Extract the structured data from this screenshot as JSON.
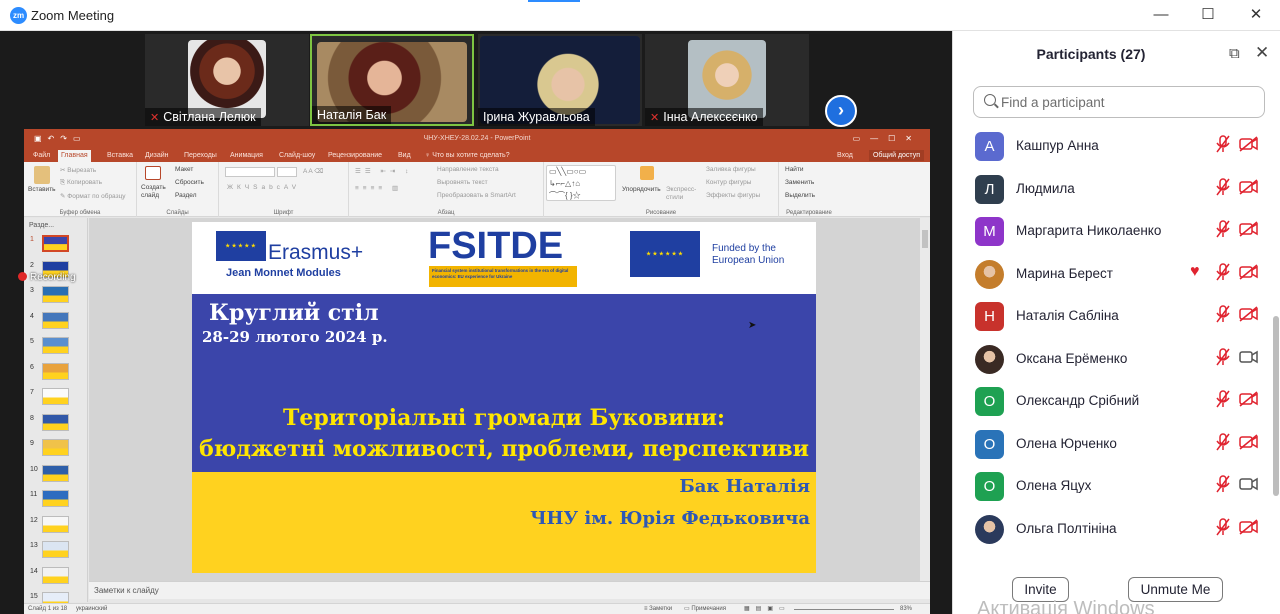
{
  "window": {
    "title": "Zoom Meeting",
    "logo_text": "zm",
    "minimize": "—",
    "maximize": "☐",
    "close": "✕"
  },
  "video_strip": {
    "participants": [
      {
        "name": "Світлана Лелюк",
        "muted": true,
        "active": false
      },
      {
        "name": "Наталія Бак",
        "muted": false,
        "active": true
      },
      {
        "name": "Ірина Журавльова",
        "muted": false,
        "active": false
      },
      {
        "name": "Інна Алексєєнко",
        "muted": true,
        "active": false
      }
    ],
    "next_icon": "chevron-right"
  },
  "recording_label": "Recording",
  "powerpoint": {
    "doc_title": "ЧНУ-ХНЕУ-28.02.24 - PowerPoint",
    "tabs": [
      "Файл",
      "Главная",
      "Вставка",
      "Дизайн",
      "Переходы",
      "Анимация",
      "Слайд-шоу",
      "Рецензирование",
      "Вид"
    ],
    "active_tab": "Главная",
    "tell_me": "Что вы хотите сделать?",
    "signin": "Вход",
    "share": "Общий доступ",
    "ribbon": {
      "paste": "Вставить",
      "cut": "Вырезать",
      "copy": "Копировать",
      "format_painter": "Формат по образцу",
      "clipboard": "Буфер обмена",
      "new_slide": "Создать слайд",
      "layout": "Макет",
      "reset": "Сбросить",
      "section": "Раздел",
      "slides": "Слайды",
      "font": "Шрифт",
      "paragraph": "Абзац",
      "text_direction": "Направление текста",
      "align_text": "Выровнять текст",
      "smartart": "Преобразовать в SmartArt",
      "arrange": "Упорядочить",
      "quick_styles": "Экспресс-стили",
      "shape_fill": "Заливка фигуры",
      "shape_outline": "Контур фигуры",
      "shape_effects": "Эффекты фигуры",
      "drawing": "Рисование",
      "find": "Найти",
      "replace": "Заменить",
      "select": "Выделить",
      "editing": "Редактирование"
    },
    "thumbs_header": "Разде...",
    "thumbnails": [
      "1",
      "2",
      "3",
      "4",
      "5",
      "6",
      "7",
      "8",
      "9",
      "10",
      "11",
      "12",
      "13",
      "14",
      "15"
    ],
    "notes_placeholder": "Заметки к слайду",
    "status": {
      "slide_of": "Слайд 1 из 18",
      "language": "украинский",
      "notes": "Заметки",
      "comments": "Примечания",
      "zoom": "83%"
    }
  },
  "slide": {
    "erasmus": "Erasmus+",
    "jean_monnet": "Jean Monnet Modules",
    "fsitde": "FSITDE",
    "fsitde_sub": "Financial system institutional transformations in the era of digital economics: EU experience for Ukraine",
    "funded": "Funded by the European Union",
    "event": "Круглий стіл",
    "date": "28-29 лютого 2024 р.",
    "topic_line1": "Територіальні громади Буковини:",
    "topic_line2": "бюджетні можливості, проблеми, перспективи",
    "author": "Бак Наталія",
    "affiliation": "ЧНУ ім. Юрія Федьковича",
    "colors": {
      "blue": "#3b45aa",
      "yellow": "#ffd21f",
      "title_yellow": "#ffe600",
      "author_blue": "#2e58b5"
    }
  },
  "panel": {
    "title": "Participants (27)",
    "search_placeholder": "Find a participant",
    "participants": [
      {
        "initial": "А",
        "name": "Кашпур Анна",
        "color": "#5b6acf",
        "photo": false,
        "heart": false,
        "mic_muted": true,
        "video_off": true
      },
      {
        "initial": "Л",
        "name": "Людмила",
        "color": "#2f3e4e",
        "photo": false,
        "heart": false,
        "mic_muted": true,
        "video_off": true
      },
      {
        "initial": "М",
        "name": "Маргарита Николаенко",
        "color": "#8e35c9",
        "photo": false,
        "heart": false,
        "mic_muted": true,
        "video_off": true
      },
      {
        "initial": "",
        "name": "Марина Берест",
        "color": "#c47d2c",
        "photo": true,
        "heart": true,
        "mic_muted": true,
        "video_off": true
      },
      {
        "initial": "Н",
        "name": "Наталія Сабліна",
        "color": "#c8322c",
        "photo": false,
        "heart": false,
        "mic_muted": true,
        "video_off": true
      },
      {
        "initial": "",
        "name": "Оксана Ерёменко",
        "color": "#3a2a24",
        "photo": true,
        "heart": false,
        "mic_muted": true,
        "video_off": false
      },
      {
        "initial": "О",
        "name": "Олександр Срібний",
        "color": "#1ea152",
        "photo": false,
        "heart": false,
        "mic_muted": true,
        "video_off": true
      },
      {
        "initial": "О",
        "name": "Олена Юрченко",
        "color": "#2a73b8",
        "photo": false,
        "heart": false,
        "mic_muted": true,
        "video_off": true
      },
      {
        "initial": "О",
        "name": "Олена Яцух",
        "color": "#1ea152",
        "photo": false,
        "heart": false,
        "mic_muted": true,
        "video_off": false
      },
      {
        "initial": "",
        "name": "Ольга Полтініна",
        "color": "#2b3a5c",
        "photo": true,
        "heart": false,
        "mic_muted": true,
        "video_off": true
      }
    ],
    "invite": "Invite",
    "unmute_me": "Unmute Me"
  },
  "watermark": "Активація Windows",
  "icons": {
    "mic_muted": "mic-muted-icon",
    "video_off": "video-off-icon",
    "video_on": "video-icon",
    "heart": "heart-icon",
    "search": "search-icon",
    "popout": "popout-icon"
  }
}
